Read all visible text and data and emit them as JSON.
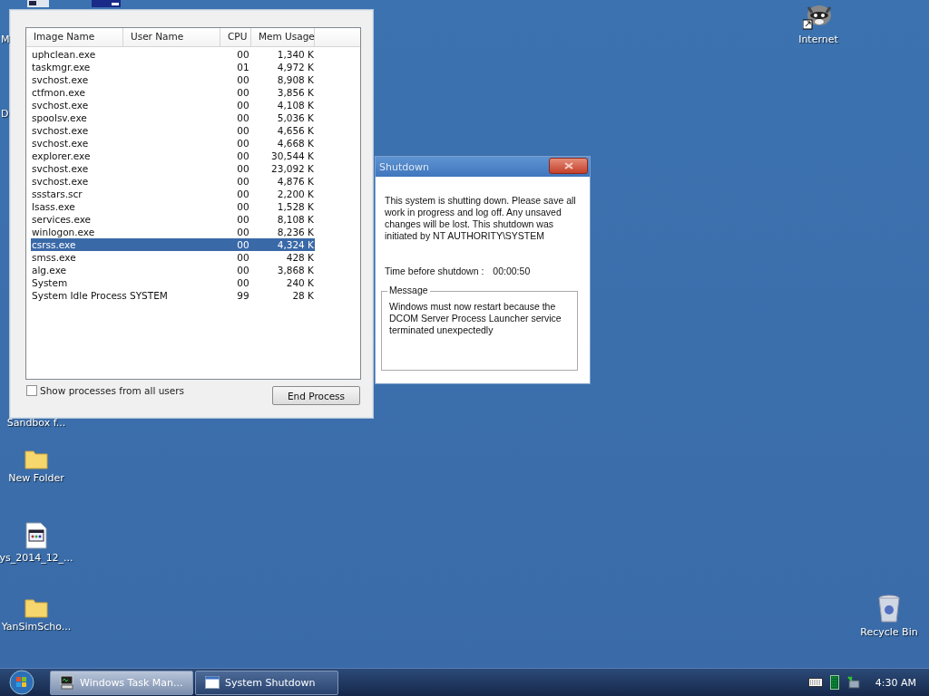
{
  "desktop_icons": [
    {
      "label": "M",
      "kind": "partial"
    },
    {
      "label": "D",
      "kind": "partial"
    },
    {
      "label": "Sandbox f...",
      "kind": "hidden"
    },
    {
      "label": "New Folder",
      "kind": "folder"
    },
    {
      "label": "ys_2014_12_...",
      "kind": "document"
    },
    {
      "label": "YanSimScho...",
      "kind": "folder"
    },
    {
      "label": "Internet",
      "kind": "shortcut"
    },
    {
      "label": "Recycle Bin",
      "kind": "recycle"
    }
  ],
  "task_manager": {
    "columns": [
      "Image Name",
      "User Name",
      "CPU",
      "Mem Usage"
    ],
    "rows": [
      {
        "image": "uphclean.exe",
        "cpu": "00",
        "mem": "1,340 K",
        "selected": false
      },
      {
        "image": "taskmgr.exe",
        "cpu": "01",
        "mem": "4,972 K",
        "selected": false
      },
      {
        "image": "svchost.exe",
        "cpu": "00",
        "mem": "8,908 K",
        "selected": false
      },
      {
        "image": "ctfmon.exe",
        "cpu": "00",
        "mem": "3,856 K",
        "selected": false
      },
      {
        "image": "svchost.exe",
        "cpu": "00",
        "mem": "4,108 K",
        "selected": false
      },
      {
        "image": "spoolsv.exe",
        "cpu": "00",
        "mem": "5,036 K",
        "selected": false
      },
      {
        "image": "svchost.exe",
        "cpu": "00",
        "mem": "4,656 K",
        "selected": false
      },
      {
        "image": "svchost.exe",
        "cpu": "00",
        "mem": "4,668 K",
        "selected": false
      },
      {
        "image": "explorer.exe",
        "cpu": "00",
        "mem": "30,544 K",
        "selected": false
      },
      {
        "image": "svchost.exe",
        "cpu": "00",
        "mem": "23,092 K",
        "selected": false
      },
      {
        "image": "svchost.exe",
        "cpu": "00",
        "mem": "4,876 K",
        "selected": false
      },
      {
        "image": "ssstars.scr",
        "cpu": "00",
        "mem": "2,200 K",
        "selected": false
      },
      {
        "image": "lsass.exe",
        "cpu": "00",
        "mem": "1,528 K",
        "selected": false
      },
      {
        "image": "services.exe",
        "cpu": "00",
        "mem": "8,108 K",
        "selected": false
      },
      {
        "image": "winlogon.exe",
        "cpu": "00",
        "mem": "8,236 K",
        "selected": false
      },
      {
        "image": "csrss.exe",
        "cpu": "00",
        "mem": "4,324 K",
        "selected": true
      },
      {
        "image": "smss.exe",
        "cpu": "00",
        "mem": "428 K",
        "selected": false
      },
      {
        "image": "alg.exe",
        "cpu": "00",
        "mem": "3,868 K",
        "selected": false
      },
      {
        "image": "System",
        "cpu": "00",
        "mem": "240 K",
        "selected": false
      },
      {
        "image": "System Idle Process",
        "user": "SYSTEM",
        "cpu": "99",
        "mem": "28 K",
        "selected": false
      }
    ],
    "show_all_users": {
      "label": "Show processes from all users",
      "checked": false
    },
    "end_button": "End Process"
  },
  "shutdown_dialog": {
    "title": "Shutdown",
    "text": "This system is shutting down. Please save all work in progress and log off. Any unsaved changes will be lost. This shutdown was initiated by NT AUTHORITY\\SYSTEM",
    "time_label": "Time before shutdown :",
    "time_value": "00:00:50",
    "message_legend": "Message",
    "message": "Windows must now restart because the DCOM Server Process Launcher service terminated unexpectedly"
  },
  "taskbar": {
    "buttons": [
      {
        "label": "Windows Task Man...",
        "kind": "taskmgr",
        "selected": true
      },
      {
        "label": "System Shutdown",
        "kind": "window",
        "selected": false
      }
    ],
    "clock": "4:30 AM"
  }
}
